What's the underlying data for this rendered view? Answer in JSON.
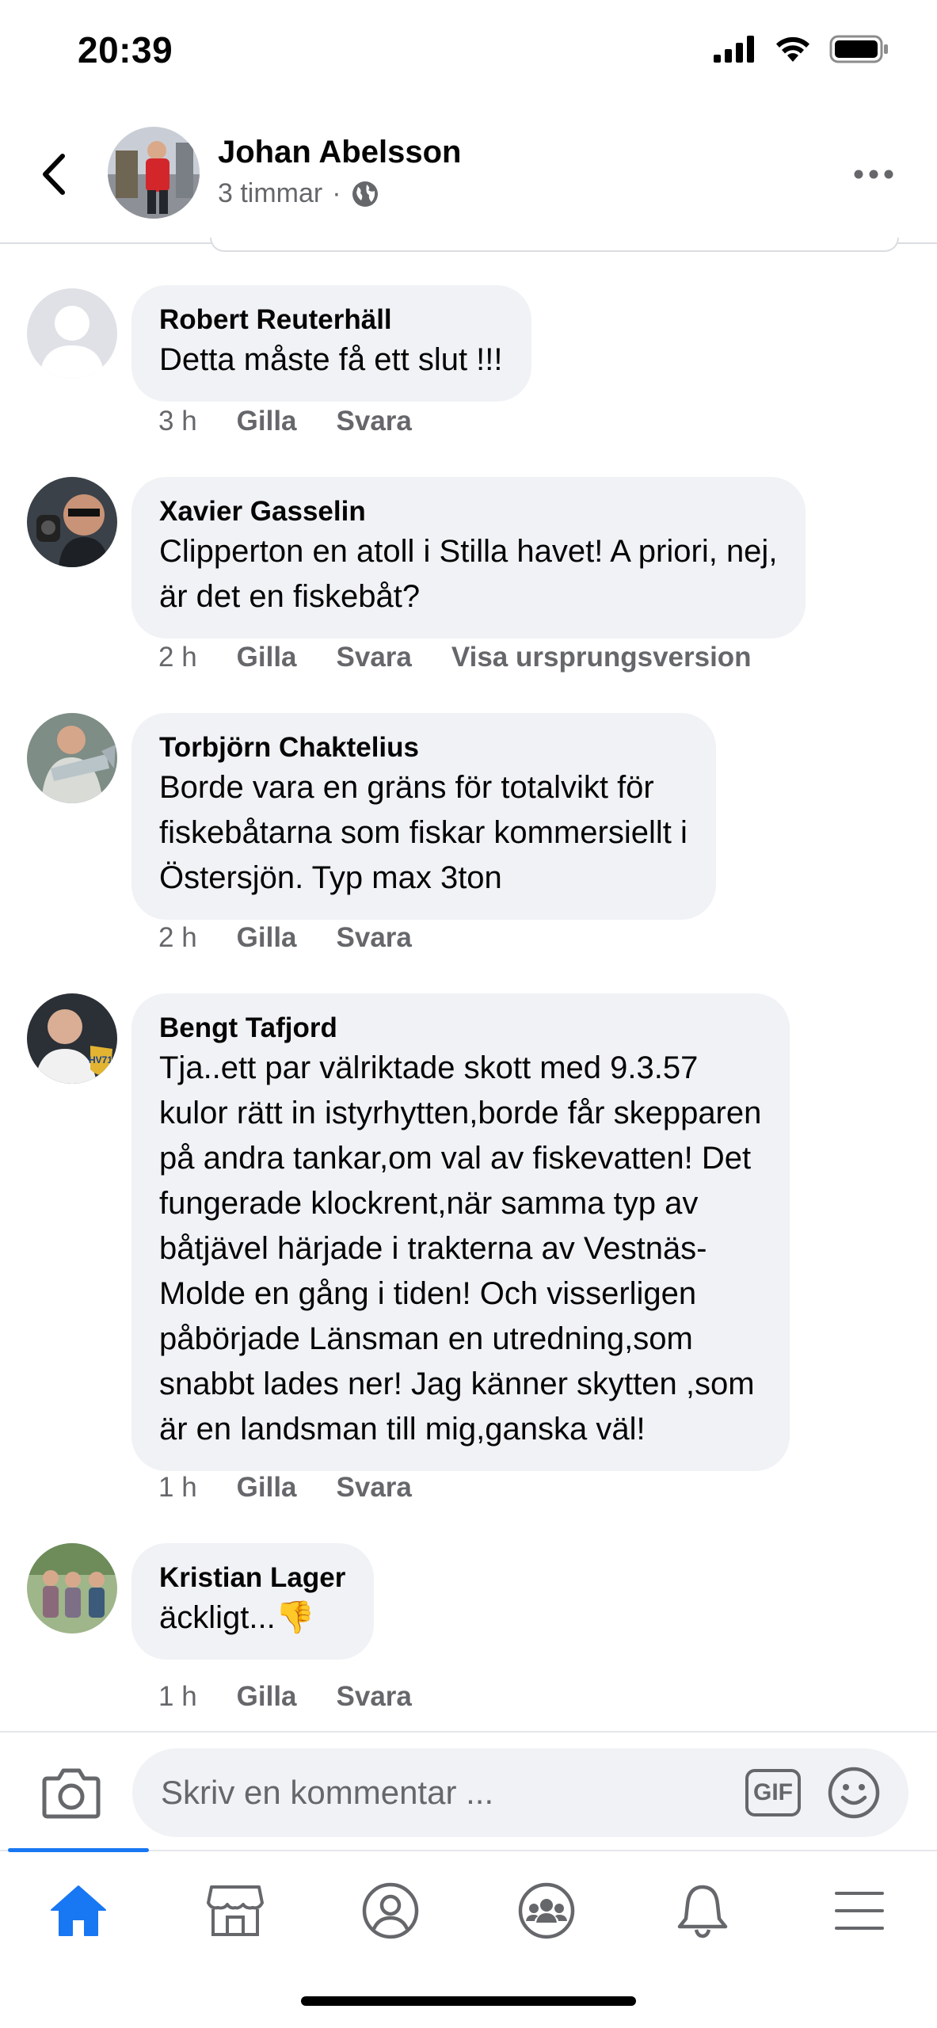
{
  "status": {
    "time": "20:39"
  },
  "post": {
    "author": "Johan Abelsson",
    "time": "3 timmar",
    "privacy_icon": "globe-icon"
  },
  "comments": [
    {
      "author": "Robert Reuterhäll",
      "text": "Detta måste få ett slut !!!",
      "time": "3 h",
      "like": "Gilla",
      "reply": "Svara",
      "extra": ""
    },
    {
      "author": "Xavier Gasselin",
      "text": "Clipperton en atoll i Stilla havet! A priori, nej,\när det en fiskebåt?",
      "time": "2 h",
      "like": "Gilla",
      "reply": "Svara",
      "extra": "Visa ursprungsversion"
    },
    {
      "author": "Torbjörn Chaktelius",
      "text": "Borde vara en gräns för totalvikt för\nfiskebåtarna som fiskar kommersiellt i\nÖstersjön.  Typ max 3ton",
      "time": "2 h",
      "like": "Gilla",
      "reply": "Svara",
      "extra": ""
    },
    {
      "author": "Bengt Tafjord",
      "text": "Tja..ett par välriktade skott med  9.3.57\nkulor rätt in istyrhytten,borde får skepparen\npå andra tankar,om val av fiskevatten! Det\nfungerade klockrent,när samma typ av\nbåtjävel härjade i trakterna av Vestnäs-\nMolde en gång i tiden! Och visserligen\npåbörjade Länsman en utredning,som\nsnabbt lades ner! Jag känner skytten ,som\när en landsman till mig,ganska väl!",
      "time": "1 h",
      "like": "Gilla",
      "reply": "Svara",
      "extra": "",
      "avatar_badge": "HV71"
    },
    {
      "author": "Kristian Lager",
      "text": "äckligt...👎",
      "time": "1 h",
      "like": "Gilla",
      "reply": "Svara",
      "extra": ""
    }
  ],
  "composer": {
    "placeholder": "Skriv en kommentar ...",
    "gif_label": "GIF"
  },
  "nav": {
    "items": [
      "home-icon",
      "marketplace-icon",
      "profile-icon",
      "groups-icon",
      "notifications-icon",
      "menu-icon"
    ],
    "active": "home-icon",
    "accent": "#1877f2"
  },
  "colors": {
    "bubble": "#f0f2f5",
    "secondary_text": "#65676b"
  }
}
